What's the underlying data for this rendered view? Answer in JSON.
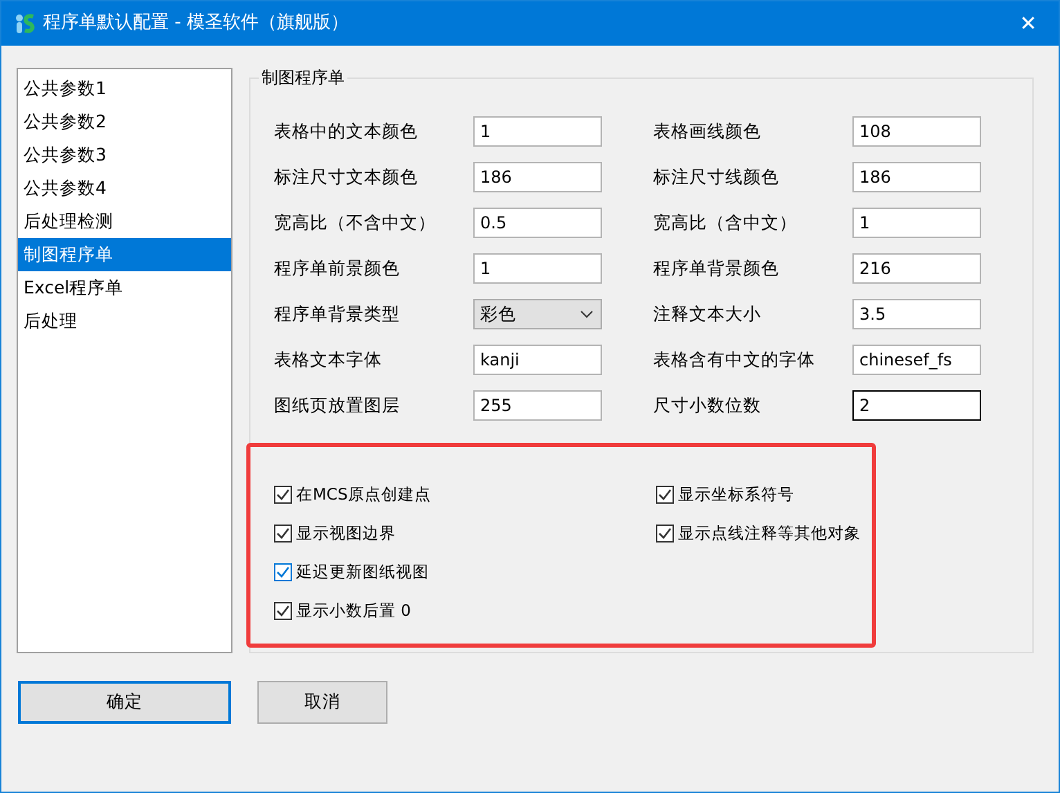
{
  "window": {
    "title": "程序单默认配置 - 模圣软件（旗舰版）",
    "close": "✕"
  },
  "sidebar": {
    "items": [
      {
        "label": "公共参数1",
        "selected": false
      },
      {
        "label": "公共参数2",
        "selected": false
      },
      {
        "label": "公共参数3",
        "selected": false
      },
      {
        "label": "公共参数4",
        "selected": false
      },
      {
        "label": "后处理检测",
        "selected": false
      },
      {
        "label": "制图程序单",
        "selected": true
      },
      {
        "label": "Excel程序单",
        "selected": false
      },
      {
        "label": "后处理",
        "selected": false
      }
    ]
  },
  "group": {
    "title": "制图程序单",
    "fields": [
      {
        "label": "表格中的文本颜色",
        "kind": "text",
        "value": "1"
      },
      {
        "label": "表格画线颜色",
        "kind": "text",
        "value": "108"
      },
      {
        "label": "标注尺寸文本颜色",
        "kind": "text",
        "value": "186"
      },
      {
        "label": "标注尺寸线颜色",
        "kind": "text",
        "value": "186"
      },
      {
        "label": "宽高比（不含中文）",
        "kind": "text",
        "value": "0.5"
      },
      {
        "label": "宽高比（含中文）",
        "kind": "text",
        "value": "1"
      },
      {
        "label": "程序单前景颜色",
        "kind": "text",
        "value": "1"
      },
      {
        "label": "程序单背景颜色",
        "kind": "text",
        "value": "216"
      },
      {
        "label": "程序单背景类型",
        "kind": "select",
        "value": "彩色"
      },
      {
        "label": "注释文本大小",
        "kind": "text",
        "value": "3.5"
      },
      {
        "label": "表格文本字体",
        "kind": "text",
        "value": "kanji"
      },
      {
        "label": "表格含有中文的字体",
        "kind": "text",
        "value": "chinesef_fs"
      },
      {
        "label": "图纸页放置图层",
        "kind": "text",
        "value": "255"
      },
      {
        "label": "尺寸小数位数",
        "kind": "text",
        "value": "2",
        "focused": true
      }
    ],
    "checkboxes_left": [
      {
        "label": "在MCS原点创建点",
        "checked": true
      },
      {
        "label": "显示视图边界",
        "checked": true
      },
      {
        "label": "延迟更新图纸视图",
        "checked": true,
        "hover": true
      },
      {
        "label": "显示小数后置 0",
        "checked": true
      }
    ],
    "checkboxes_right": [
      {
        "label": "显示坐标系符号",
        "checked": true
      },
      {
        "label": "显示点线注释等其他对象",
        "checked": true
      }
    ]
  },
  "buttons": [
    {
      "label": "确定",
      "default": true
    },
    {
      "label": "取消",
      "default": false
    }
  ]
}
